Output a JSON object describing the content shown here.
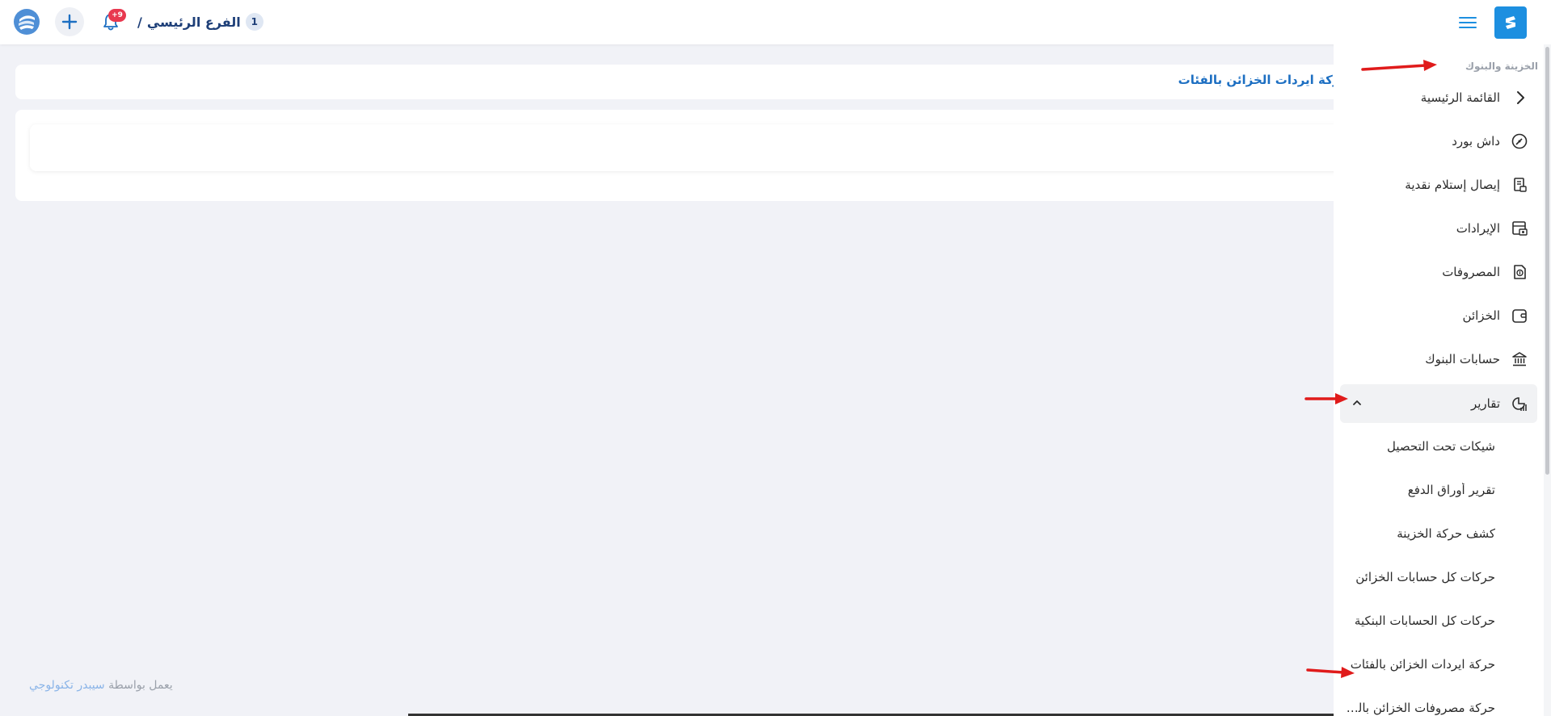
{
  "header": {
    "branch_number": "1",
    "branch_name": "الفرع الرئيسي",
    "separator": "/",
    "notification_count": "+9",
    "icons": [
      "logo-icon",
      "plus-icon",
      "bell-icon",
      "brand-logo-icon",
      "hamburger-menu-icon"
    ]
  },
  "page": {
    "title": "حركة ايردات الخزائن بالفئات"
  },
  "footer": {
    "prefix": "يعمل بواسطة",
    "brand": "سيبدر تكنولوجي"
  },
  "sidebar": {
    "section_label": "الخزينة والبنوك",
    "items": [
      {
        "label": "القائمة الرئيسية",
        "icon": "chevron-left-icon"
      },
      {
        "label": "داش بورد",
        "icon": "dashboard-gauge-icon"
      },
      {
        "label": "إيصال إستلام نقدية",
        "icon": "cash-receipt-icon"
      },
      {
        "label": "الإيرادات",
        "icon": "revenue-icon"
      },
      {
        "label": "المصروفات",
        "icon": "expenses-icon"
      },
      {
        "label": "الخزائن",
        "icon": "wallet-icon"
      },
      {
        "label": "حسابات البنوك",
        "icon": "bank-icon"
      },
      {
        "label": "تقارير",
        "icon": "reports-chart-icon",
        "expanded": true
      }
    ],
    "report_sub_items": [
      "شيكات تحت التحصيل",
      "تقرير أوراق الدفع",
      "كشف حركة الخزينة",
      "حركات كل حسابات الخزائن",
      "حركات كل الحسابات البنكية",
      "حركة ايردات الخزائن بالفئات",
      "حركة مصروفات الخزائن بالفئات"
    ]
  },
  "colors": {
    "brand_blue": "#1d8fe0",
    "title_blue": "#1d6fc2",
    "badge_red": "#e8384f",
    "annotation_red": "#e01b1b",
    "background": "#f1f2f7"
  }
}
